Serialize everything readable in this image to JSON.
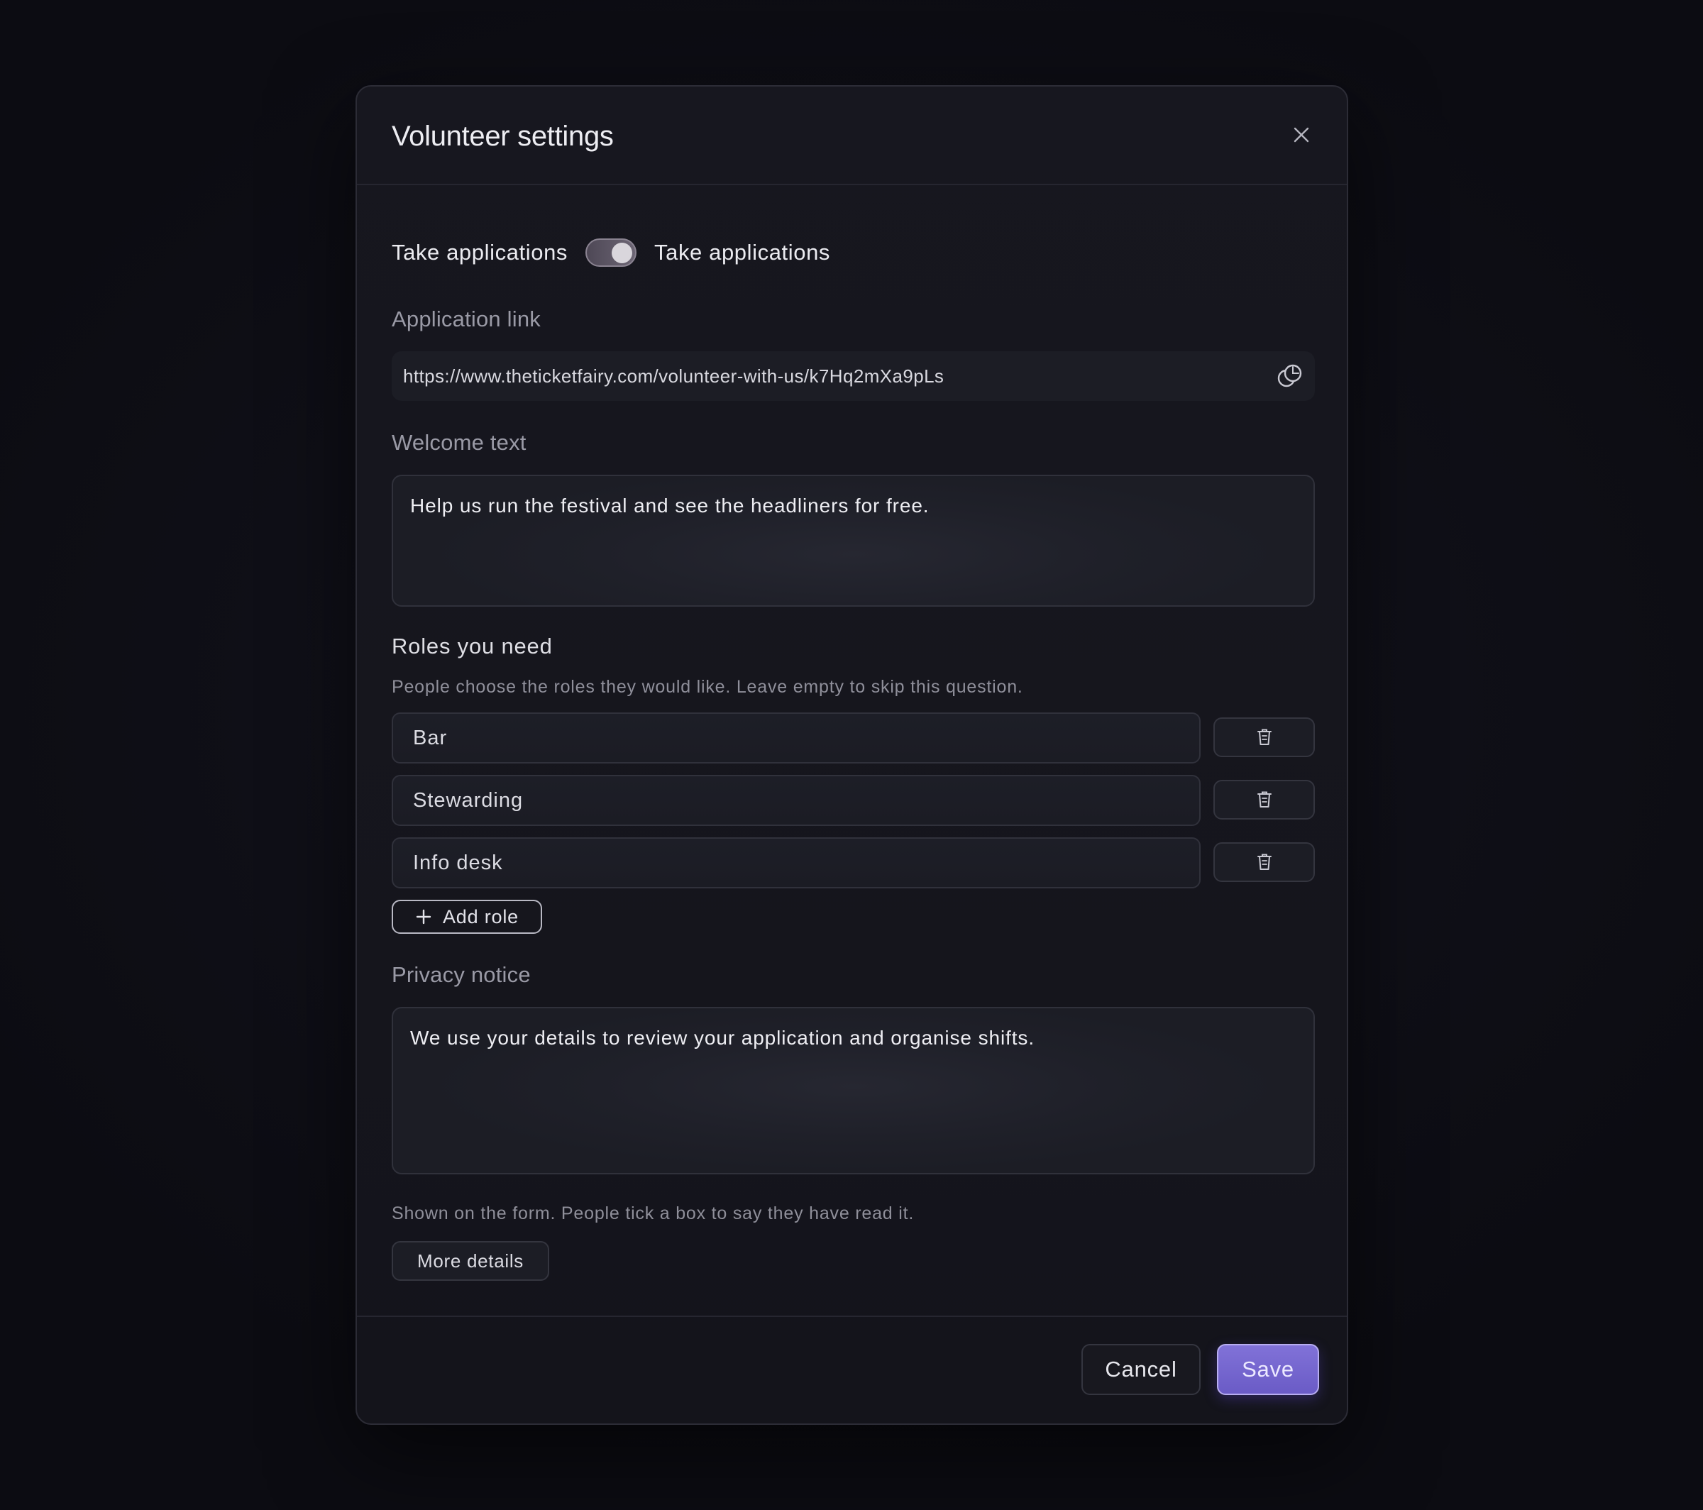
{
  "dialog": {
    "title": "Volunteer settings"
  },
  "toggle": {
    "left_label": "Take applications",
    "right_label": "Take applications",
    "state": "on"
  },
  "application_link": {
    "label": "Application link",
    "value": "https://www.theticketfairy.com/volunteer-with-us/k7Hq2mXa9pLs"
  },
  "welcome_text": {
    "label": "Welcome text",
    "value": "Help us run the festival and see the headliners for free."
  },
  "roles": {
    "label": "Roles you need",
    "help": "People choose the roles they would like. Leave empty to skip this question.",
    "items": [
      {
        "value": "Bar"
      },
      {
        "value": "Stewarding"
      },
      {
        "value": "Info desk"
      }
    ],
    "add_label": "Add role"
  },
  "privacy": {
    "label": "Privacy notice",
    "value": "We use your details to review your application and organise shifts.",
    "help": "Shown on the form. People tick a box to say they have read it."
  },
  "more_details_label": "More details",
  "footer": {
    "cancel_label": "Cancel",
    "save_label": "Save"
  },
  "colors": {
    "accent": "#7466d0",
    "background": "#0f0f16",
    "panel": "#16161d"
  },
  "icons": [
    "close-icon",
    "copy-icon",
    "trash-icon",
    "plus-icon"
  ]
}
